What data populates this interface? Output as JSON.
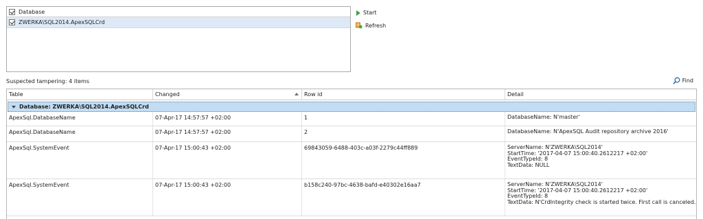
{
  "databases": {
    "header": "Database",
    "items": [
      {
        "name": "ZWERKA\\SQL2014.ApexSQLCrd",
        "checked": true
      }
    ]
  },
  "actions": {
    "start_label": "Start",
    "refresh_label": "Refresh"
  },
  "suspected_label": "Suspected tampering: 4 items",
  "find_label": "Find",
  "grid": {
    "columns": [
      "Table",
      "Changed",
      "Row id",
      "Detail"
    ],
    "group_label": "Database: ZWERKA\\SQL2014.ApexSQLCrd",
    "rows": [
      {
        "table": "ApexSql.DatabaseName",
        "changed": "07-Apr-17 14:57:57 +02:00",
        "row_id": "1",
        "detail": [
          "DatabaseName: N'master'"
        ]
      },
      {
        "table": "ApexSql.DatabaseName",
        "changed": "07-Apr-17 14:57:57 +02:00",
        "row_id": "2",
        "detail": [
          "DatabaseName: N'ApexSQL Audit repository archive 2016'"
        ]
      },
      {
        "table": "ApexSql.SystemEvent",
        "changed": "07-Apr-17 15:00:43 +02:00",
        "row_id": "69843059-6488-403c-a03f-2279c44ff889",
        "detail": [
          "ServerName: N'ZWERKA\\SQL2014'",
          "StartTime: '2017-04-07 15:00:40.2612217 +02:00'",
          "EventTypeId: 8",
          "TextData: NULL"
        ]
      },
      {
        "table": "ApexSql.SystemEvent",
        "changed": "07-Apr-17 15:00:43 +02:00",
        "row_id": "b158c240-97bc-4638-bafd-e40302e16aa7",
        "detail": [
          "ServerName: N'ZWERKA\\SQL2014'",
          "StartTime: '2017-04-07 15:00:40.2612217 +02:00'",
          "EventTypeId: 8",
          "TextData: N'CrdIntegrity check is started twice. First call is canceled.'"
        ]
      }
    ]
  }
}
